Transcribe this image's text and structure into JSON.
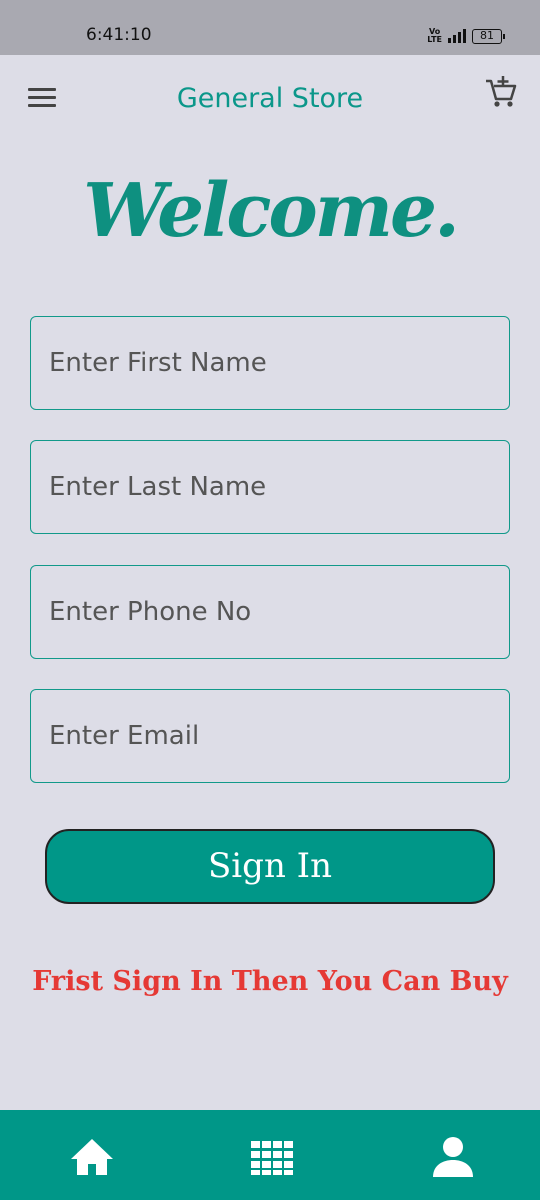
{
  "status_bar": {
    "time": "6:41:10",
    "network": "Vo LTE",
    "battery": "81"
  },
  "app_bar": {
    "title": "General Store",
    "menu_icon": "hamburger-menu-icon",
    "cart_icon": "add-to-cart-icon"
  },
  "main": {
    "welcome": "Welcome.",
    "fields": {
      "first_name_placeholder": "Enter First Name",
      "last_name_placeholder": "Enter Last Name",
      "phone_placeholder": "Enter Phone No",
      "email_placeholder": "Enter Email"
    },
    "signin_label": "Sign In",
    "notice": "Frist Sign In Then You Can Buy"
  },
  "bottom_nav": {
    "items": [
      "home-icon",
      "grid-icon",
      "person-icon"
    ]
  },
  "colors": {
    "accent": "#009788",
    "background": "#dddde7",
    "notice": "#e53935"
  }
}
